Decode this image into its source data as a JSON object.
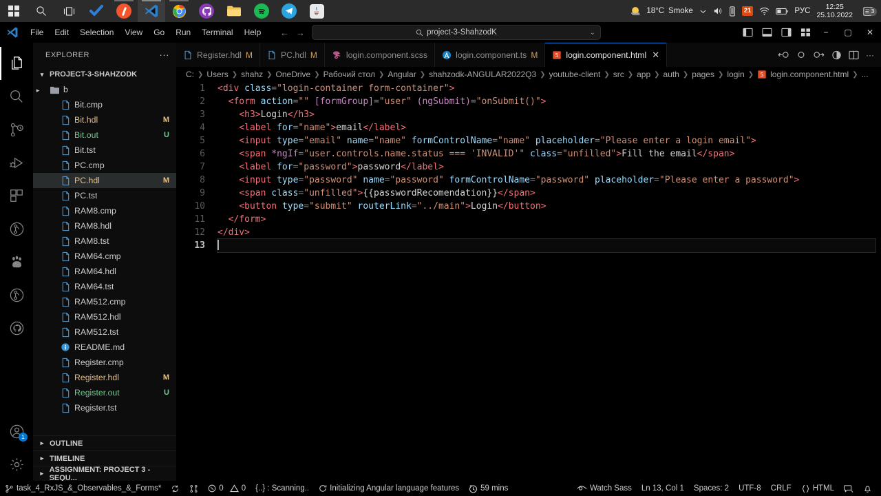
{
  "taskbar": {
    "apps": [
      {
        "name": "start-button",
        "icon": "windows-logo"
      },
      {
        "name": "search",
        "icon": "search-icon"
      },
      {
        "name": "task-view",
        "icon": "task-view-icon"
      },
      {
        "name": "todoist",
        "icon": "checkmark-icon"
      },
      {
        "name": "webstorm",
        "icon": "circle-app-icon"
      },
      {
        "name": "vscode",
        "icon": "vscode-icon"
      },
      {
        "name": "chrome",
        "icon": "chrome-icon"
      },
      {
        "name": "github-desktop",
        "icon": "github-icon"
      },
      {
        "name": "file-explorer",
        "icon": "folder-icon"
      },
      {
        "name": "spotify",
        "icon": "spotify-icon"
      },
      {
        "name": "telegram",
        "icon": "telegram-icon"
      },
      {
        "name": "java-app",
        "icon": "java-icon"
      }
    ],
    "tray": {
      "weather_temp": "18°C",
      "weather_desc": "Smoke",
      "chevron": "⌄",
      "volume_icon": "speaker-icon",
      "battery_saver_icon": "battery-icon",
      "update_badge": "21",
      "wifi_icon": "wifi-icon",
      "power_icon": "battery-status-icon",
      "language": "РУС",
      "time": "12:25",
      "date": "25.10.2022",
      "notification_count": "3"
    }
  },
  "titlebar": {
    "logo": "vscode-logo-icon",
    "menu": [
      "File",
      "Edit",
      "Selection",
      "View",
      "Go",
      "Run",
      "Terminal",
      "Help"
    ],
    "back_icon": "arrow-left-icon",
    "forward_icon": "arrow-right-icon",
    "search_value": "project-3-ShahzodK",
    "search_icon": "search-icon",
    "chevron": "⌄",
    "layout_icons": [
      "panel-left-icon",
      "panel-bottom-icon",
      "panel-right-icon",
      "layout-grid-icon"
    ],
    "minimize": "−",
    "maximize": "▢",
    "close": "✕"
  },
  "activitybar": {
    "items": [
      {
        "name": "explorer",
        "icon": "files-icon",
        "active": true
      },
      {
        "name": "search",
        "icon": "search-icon",
        "active": false
      },
      {
        "name": "source-control",
        "icon": "source-control-icon",
        "active": false
      },
      {
        "name": "run-debug",
        "icon": "debug-icon",
        "active": false
      },
      {
        "name": "extensions",
        "icon": "extensions-icon",
        "active": false
      },
      {
        "name": "gitlens",
        "icon": "gitlens-icon",
        "active": false
      },
      {
        "name": "baidu",
        "icon": "paw-icon",
        "active": false
      },
      {
        "name": "git-graph",
        "icon": "git-branch-icon",
        "active": false
      },
      {
        "name": "github",
        "icon": "github-icon",
        "active": false
      }
    ],
    "accounts_icon": "account-icon",
    "accounts_badge": "1",
    "settings_icon": "gear-icon"
  },
  "sidebar": {
    "title": "EXPLORER",
    "more_actions": "···",
    "root_label": "PROJECT-3-SHAHZODK",
    "files": [
      {
        "label": "b",
        "type": "folder",
        "badge": "",
        "selected": false,
        "color": "normal"
      },
      {
        "label": "Bit.cmp",
        "type": "file",
        "badge": "",
        "selected": false,
        "color": "normal"
      },
      {
        "label": "Bit.hdl",
        "type": "file",
        "badge": "M",
        "selected": false,
        "color": "modified"
      },
      {
        "label": "Bit.out",
        "type": "file",
        "badge": "U",
        "selected": false,
        "color": "untracked"
      },
      {
        "label": "Bit.tst",
        "type": "file",
        "badge": "",
        "selected": false,
        "color": "normal"
      },
      {
        "label": "PC.cmp",
        "type": "file",
        "badge": "",
        "selected": false,
        "color": "normal"
      },
      {
        "label": "PC.hdl",
        "type": "file",
        "badge": "M",
        "selected": true,
        "color": "modified"
      },
      {
        "label": "PC.tst",
        "type": "file",
        "badge": "",
        "selected": false,
        "color": "normal"
      },
      {
        "label": "RAM8.cmp",
        "type": "file",
        "badge": "",
        "selected": false,
        "color": "normal"
      },
      {
        "label": "RAM8.hdl",
        "type": "file",
        "badge": "",
        "selected": false,
        "color": "normal"
      },
      {
        "label": "RAM8.tst",
        "type": "file",
        "badge": "",
        "selected": false,
        "color": "normal"
      },
      {
        "label": "RAM64.cmp",
        "type": "file",
        "badge": "",
        "selected": false,
        "color": "normal"
      },
      {
        "label": "RAM64.hdl",
        "type": "file",
        "badge": "",
        "selected": false,
        "color": "normal"
      },
      {
        "label": "RAM64.tst",
        "type": "file",
        "badge": "",
        "selected": false,
        "color": "normal"
      },
      {
        "label": "RAM512.cmp",
        "type": "file",
        "badge": "",
        "selected": false,
        "color": "normal"
      },
      {
        "label": "RAM512.hdl",
        "type": "file",
        "badge": "",
        "selected": false,
        "color": "normal"
      },
      {
        "label": "RAM512.tst",
        "type": "file",
        "badge": "",
        "selected": false,
        "color": "normal"
      },
      {
        "label": "README.md",
        "type": "info",
        "badge": "",
        "selected": false,
        "color": "normal"
      },
      {
        "label": "Register.cmp",
        "type": "file",
        "badge": "",
        "selected": false,
        "color": "normal"
      },
      {
        "label": "Register.hdl",
        "type": "file",
        "badge": "M",
        "selected": false,
        "color": "modified"
      },
      {
        "label": "Register.out",
        "type": "file",
        "badge": "U",
        "selected": false,
        "color": "untracked"
      },
      {
        "label": "Register.tst",
        "type": "file",
        "badge": "",
        "selected": false,
        "color": "normal"
      }
    ],
    "bottom_sections": [
      "OUTLINE",
      "TIMELINE",
      "ASSIGNMENT: PROJECT 3 - SEQU..."
    ]
  },
  "tabs": {
    "items": [
      {
        "label": "Register.hdl",
        "badge": "M",
        "icon": "file-icon",
        "active": false,
        "close": ""
      },
      {
        "label": "PC.hdl",
        "badge": "M",
        "icon": "file-icon",
        "active": false,
        "close": ""
      },
      {
        "label": "login.component.scss",
        "badge": "",
        "icon": "sass-icon",
        "active": false,
        "close": ""
      },
      {
        "label": "login.component.ts",
        "badge": "M",
        "icon": "angular-icon",
        "active": false,
        "close": ""
      },
      {
        "label": "login.component.html",
        "badge": "",
        "icon": "html-icon",
        "active": true,
        "close": "✕"
      }
    ],
    "actions": [
      "compare-icon",
      "prev-change-icon",
      "next-change-icon",
      "split-diff-icon",
      "split-editor-icon",
      "more-actions-icon"
    ]
  },
  "breadcrumb": {
    "parts": [
      "C:",
      "Users",
      "shahz",
      "OneDrive",
      "Рабочий стол",
      "Angular",
      "shahzodk-ANGULAR2022Q3",
      "youtube-client",
      "src",
      "app",
      "auth",
      "pages",
      "login"
    ],
    "file": "login.component.html",
    "trailing": "..."
  },
  "editor": {
    "line_numbers": [
      "1",
      "2",
      "3",
      "4",
      "5",
      "6",
      "7",
      "8",
      "9",
      "10",
      "11",
      "12",
      "13"
    ],
    "current_line": 13,
    "lines": [
      "<div class=\"login-container form-container\">",
      "  <form action=\"\" [formGroup]=\"user\" (ngSubmit)=\"onSubmit()\">",
      "    <h3>Login</h3>",
      "    <label for=\"name\">email</label>",
      "    <input type=\"email\" name=\"name\" formControlName=\"name\" placeholder=\"Please enter a login email\">",
      "    <span *ngIf=\"user.controls.name.status === 'INVALID'\" class=\"unfilled\">Fill the email</span>",
      "    <label for=\"password\">password</label>",
      "    <input type=\"password\" name=\"password\" formControlName=\"password\" placeholder=\"Please enter a password\">",
      "    <span class=\"unfilled\">{{passwordRecomendation}}</span>",
      "    <button type=\"submit\" routerLink=\"../main\">Login</button>",
      "  </form>",
      "</div>",
      ""
    ]
  },
  "statusbar": {
    "branch_icon": "source-control-icon",
    "branch": "task_4_RxJS_&_Observables_&_Forms*",
    "sync_icon": "sync-icon",
    "split_icon": "git-compare-icon",
    "errors_icon": "error-icon",
    "errors": "0",
    "warnings_icon": "warning-icon",
    "warnings": "0",
    "scanning": "{..} : Scanning..",
    "angular_icon": "loading-icon",
    "angular": "Initializing Angular language features",
    "clock_icon": "clock-icon",
    "time_tracked": "59 mins",
    "watch_sass_icon": "eye-icon",
    "watch_sass": "Watch Sass",
    "cursor_position": "Ln 13, Col 1",
    "indentation": "Spaces: 2",
    "encoding": "UTF-8",
    "eol": "CRLF",
    "language_icon": "braces-icon",
    "language": "HTML",
    "feedback_icon": "feedback-icon",
    "bell_icon": "bell-icon"
  },
  "colors": {
    "accent": "#0078d4",
    "modified": "#e2c08d",
    "untracked": "#73c991",
    "tag": "#f07178",
    "attribute": "#9cdcfe",
    "string": "#ce9178"
  }
}
